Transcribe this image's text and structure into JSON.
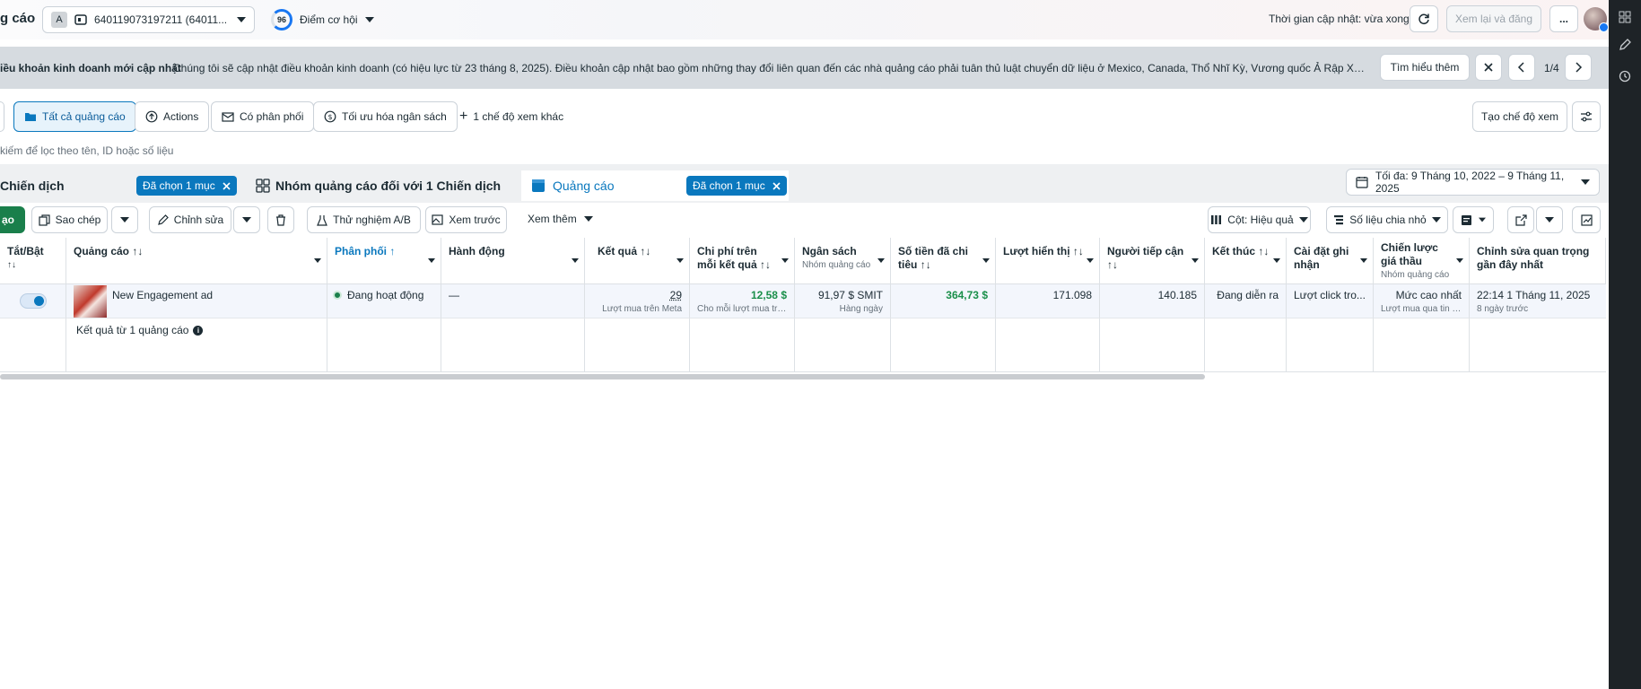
{
  "header": {
    "title_fragment": "g cáo",
    "account_letter": "A",
    "account_id": "640119073197211 (64011...",
    "opportunity_score": "96",
    "opportunity_label": "Điểm cơ hội",
    "update_time": "Thời gian cập nhật: vừa xong",
    "review_publish": "Xem lại và đăng",
    "more": "..."
  },
  "notice": {
    "title": "iều khoản kinh doanh mới cập nhật",
    "text": "Chúng tôi sẽ cập nhật điều khoản kinh doanh (có hiệu lực từ 23 tháng 8, 2025). Điều khoản cập nhật bao gồm những thay đổi liên quan đến các nhà quảng cáo phải tuân thủ luật chuyển dữ liệu ở Mexico, Canada, Thổ Nhĩ Kỳ, Vương quốc Ả Rập Xê Út, Trung Mỹ và ...",
    "learn_more": "Tìm hiểu thêm",
    "pager": "1/4"
  },
  "views": {
    "all_ads": "Tất cả quảng cáo",
    "actions": "Actions",
    "delivering": "Có phân phối",
    "budget_opt": "Tối ưu hóa ngân sách",
    "more_views": "1 chế độ xem khác",
    "create_view": "Tạo chế độ xem"
  },
  "search": {
    "placeholder": " kiếm để lọc theo tên, ID hoặc số liệu"
  },
  "levels": {
    "campaign": "Chiến dịch",
    "campaign_selected": "Đã chọn 1 mục",
    "adset": "Nhóm quảng cáo đối với 1 Chiến dịch",
    "ads": "Quảng cáo",
    "ads_selected": "Đã chọn 1 mục",
    "date_range": "Tối đa: 9 Tháng 10, 2022 – 9 Tháng 11, 2025"
  },
  "toolbar": {
    "create": "ạo",
    "duplicate": "Sao chép",
    "edit": "Chỉnh sửa",
    "ab_test": "Thử nghiệm A/B",
    "preview": "Xem trước",
    "see_more": "Xem thêm",
    "columns": "Cột: Hiệu quả",
    "breakdown": "Số liệu chia nhỏ"
  },
  "table": {
    "headers": {
      "toggle": "Tắt/Bật",
      "ad": "Quảng cáo",
      "delivery": "Phân phối",
      "actions": "Hành động",
      "results": "Kết quả",
      "cost_per_result": "Chi phí trên mỗi kết quả",
      "budget": "Ngân sách",
      "budget_sub": "Nhóm quảng cáo",
      "amount_spent": "Số tiền đã chi tiêu",
      "impressions": "Lượt hiển thị",
      "reach": "Người tiếp cận",
      "ends": "Kết thúc",
      "attribution": "Cài đặt ghi nhận",
      "bid_strategy": "Chiến lược giá thầu",
      "bid_sub": "Nhóm quảng cáo",
      "last_edit": "Chỉnh sửa quan trọng gần đây nhất"
    },
    "row": {
      "ad_name": "New Engagement ad",
      "delivery": "Đang hoạt động",
      "actions": "—",
      "results": "29",
      "results_sub": "Lượt mua trên Meta",
      "cost": "12,58 $",
      "cost_sub": "Cho mỗi lượt mua trê...",
      "budget": "91,97 $ SMIT",
      "budget_sub": "Hàng ngày",
      "spent": "364,73 $",
      "impressions": "171.098",
      "reach": "140.185",
      "ends": "Đang diễn ra",
      "attribution": "Lượt click tro...",
      "bid": "Mức cao nhất",
      "bid_sub": "Lượt mua qua tin n...",
      "last_edit": "22:14 1 Tháng 11, 2025",
      "last_edit_sub": "8 ngày trước"
    },
    "footer": "Kết quả từ 1 quảng cáo"
  }
}
